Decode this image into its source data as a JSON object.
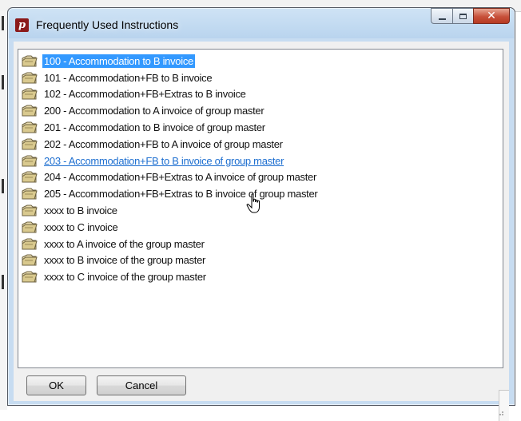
{
  "window": {
    "title": "Frequently Used Instructions",
    "app_icon_letter": "p"
  },
  "caption_buttons": {
    "minimize": "minimize-icon",
    "maximize": "maximize-icon",
    "close": "close-icon"
  },
  "list": {
    "items": [
      {
        "label": "100 - Accommodation to B invoice",
        "state": "selected"
      },
      {
        "label": "101 - Accommodation+FB to B invoice",
        "state": "normal"
      },
      {
        "label": "102 - Accommodation+FB+Extras to B invoice",
        "state": "normal"
      },
      {
        "label": "200 - Accommodation to A invoice of group master",
        "state": "normal"
      },
      {
        "label": "201 - Accommodation to B invoice of group master",
        "state": "normal"
      },
      {
        "label": "202 - Accommodation+FB to A invoice of group master",
        "state": "normal"
      },
      {
        "label": "203 - Accommodation+FB to B invoice of group master",
        "state": "hover"
      },
      {
        "label": "204 - Accommodation+FB+Extras to A invoice of group master",
        "state": "normal"
      },
      {
        "label": "205 - Accommodation+FB+Extras to B invoice of group master",
        "state": "normal"
      },
      {
        "label": "xxxx to B invoice",
        "state": "normal"
      },
      {
        "label": "xxxx to C invoice",
        "state": "normal"
      },
      {
        "label": "xxxx to A invoice of the group master",
        "state": "normal"
      },
      {
        "label": "xxxx to B invoice of the group master",
        "state": "normal"
      },
      {
        "label": "xxxx to C invoice of the group master",
        "state": "normal"
      }
    ]
  },
  "buttons": {
    "ok": "OK",
    "cancel": "Cancel"
  },
  "colors": {
    "selection": "#3399ff",
    "hover_link": "#1e6fd0",
    "close_button": "#c7503a"
  }
}
